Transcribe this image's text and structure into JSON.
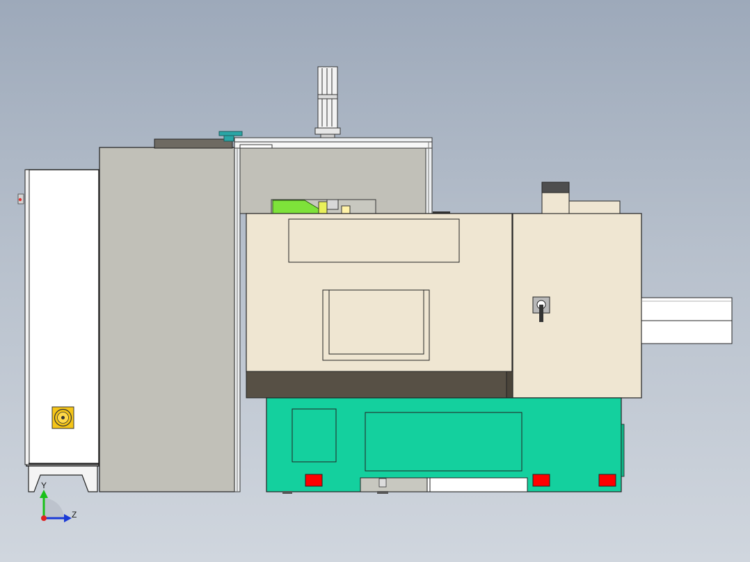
{
  "view": {
    "background_top": "#9da9ba",
    "background_bottom": "#d0d6de"
  },
  "colors": {
    "cabinet_white": "#ffffff",
    "enclosure_gray": "#c0c0b8",
    "beige_housing": "#efe6d2",
    "dark_band": "#575045",
    "base_green": "#14d09e",
    "stop_red": "#ff0000",
    "warning_yellow": "#f5c518",
    "gripper_green": "#7ee23a",
    "cap_teal": "#2aa6a6",
    "outline": "#222222"
  },
  "triad": {
    "y_label": "Y",
    "z_label": "Z",
    "y_color": "#19c019",
    "z_color": "#1a3ad6",
    "origin_color": "#e02020"
  },
  "icons": {
    "fan": "fan-icon",
    "selector_switch": "selector-switch-icon",
    "coordinate_triad": "coordinate-triad-icon"
  }
}
